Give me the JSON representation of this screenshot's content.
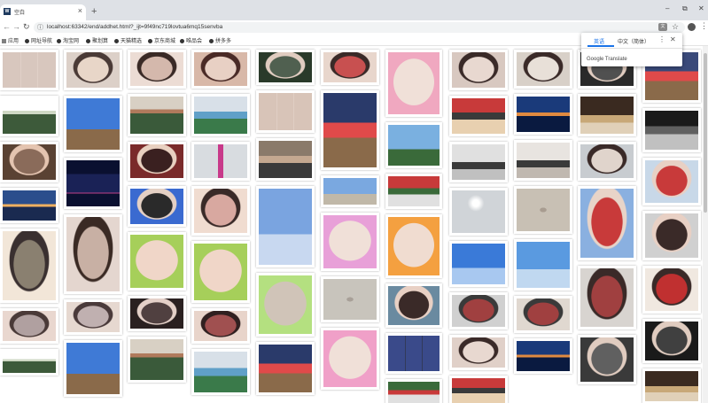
{
  "browser": {
    "tab_title": "空白",
    "tab_favicon": "W",
    "new_tab_label": "+",
    "window_controls": [
      "–",
      "⧉",
      "✕"
    ],
    "url": "localhost:63342/end/addhet.html?_ijt=9f49nc719lovtua6mq15senvba"
  },
  "bookmarks": [
    {
      "label": "应用",
      "icon": "apps-grid-icon"
    },
    {
      "label": "网址导航",
      "icon": "globe-icon"
    },
    {
      "label": "淘宝网",
      "icon": "globe-icon"
    },
    {
      "label": "聚划算",
      "icon": "globe-icon"
    },
    {
      "label": "天猫精选",
      "icon": "globe-icon"
    },
    {
      "label": "京东商城",
      "icon": "globe-icon"
    },
    {
      "label": "唯品会",
      "icon": "globe-icon"
    },
    {
      "label": "拼多多",
      "icon": "globe-icon"
    }
  ],
  "translate_popup": {
    "tab_english": "英语",
    "tab_chinese": "中文（简体）",
    "brand": "Google Translate"
  },
  "gallery": {
    "columns": [
      {
        "photos": [
          {
            "kind": "selfie-grid",
            "colors": [
              "#d8c7be",
              "#6a4a3a",
              "#e9dad3"
            ]
          },
          {
            "kind": "campus-building",
            "colors": [
              "#cfd8c4",
              "#3d5a3a",
              "#ffffff"
            ]
          },
          {
            "kind": "selfie",
            "colors": [
              "#5a4233",
              "#e4c4b0",
              "#8a6b5a"
            ]
          },
          {
            "kind": "city-skyline",
            "colors": [
              "#2b4e8c",
              "#f0b060",
              "#1a2a50"
            ]
          },
          {
            "kind": "sunset-portrait",
            "colors": [
              "#f2e6d8",
              "#3a3030",
              "#8a8070"
            ]
          },
          {
            "kind": "selfie",
            "colors": [
              "#e9d7cf",
              "#4a3a38",
              "#b0a0a0"
            ]
          },
          {
            "kind": "campus-building",
            "colors": [
              "#cfd8c4",
              "#3d5a3a",
              "#ffffff"
            ]
          }
        ]
      },
      {
        "photos": [
          {
            "kind": "portrait-glasses",
            "colors": [
              "#dcd0c8",
              "#4a3a36",
              "#e8d6c8"
            ]
          },
          {
            "kind": "blue-sky-girl",
            "colors": [
              "#3f7ad6",
              "#eaeaf2",
              "#8a6a4a"
            ]
          },
          {
            "kind": "night-tower",
            "colors": [
              "#1a2256",
              "#c04088",
              "#0a1030"
            ]
          },
          {
            "kind": "portrait",
            "colors": [
              "#e4d6cf",
              "#3a2a24",
              "#c8b0a4"
            ]
          },
          {
            "kind": "selfie",
            "colors": [
              "#e6d8d0",
              "#4a3a3a",
              "#c0b0b0"
            ]
          },
          {
            "kind": "blue-sky-girl",
            "colors": [
              "#3f7ad6",
              "#eaeaf2",
              "#8a6a4a"
            ]
          }
        ]
      },
      {
        "photos": [
          {
            "kind": "portrait",
            "colors": [
              "#ecdcd4",
              "#3a2a26",
              "#d4b8ac"
            ]
          },
          {
            "kind": "old-building",
            "colors": [
              "#b07a5c",
              "#3a5a3a",
              "#d8d0c4"
            ]
          },
          {
            "kind": "selfie",
            "colors": [
              "#7a2a2a",
              "#e8d0c0",
              "#3a2020"
            ]
          },
          {
            "kind": "couple",
            "colors": [
              "#3a6ad0",
              "#e4d0c4",
              "#2a2a2a"
            ]
          },
          {
            "kind": "avocado-frame",
            "colors": [
              "#a6cf5a",
              "#f0d6c8",
              "#3a2a24"
            ]
          },
          {
            "kind": "selfie-dark",
            "colors": [
              "#2a2020",
              "#e4d0c8",
              "#504040"
            ]
          },
          {
            "kind": "old-building",
            "colors": [
              "#b07a5c",
              "#3a5a3a",
              "#d8d0c4"
            ]
          }
        ]
      },
      {
        "photos": [
          {
            "kind": "portrait",
            "colors": [
              "#d8b8a8",
              "#4a2a26",
              "#e8d0c4"
            ]
          },
          {
            "kind": "park-fountain",
            "colors": [
              "#60a0c8",
              "#3a7a4a",
              "#d8e0e8"
            ]
          },
          {
            "kind": "canton-tower",
            "colors": [
              "#d8dce0",
              "#c83a8a",
              "#a0a8b0"
            ]
          },
          {
            "kind": "selfie-glasses",
            "colors": [
              "#f0dcd0",
              "#3a2a28",
              "#d8a8a0"
            ]
          },
          {
            "kind": "avocado-frame",
            "colors": [
              "#a6cf5a",
              "#f0d6c8",
              "#3a2a24"
            ]
          },
          {
            "kind": "selfie",
            "colors": [
              "#e8d4ca",
              "#302020",
              "#a05050"
            ]
          },
          {
            "kind": "park-fountain",
            "colors": [
              "#60a0c8",
              "#3a7a4a",
              "#d8e0e8"
            ]
          }
        ]
      },
      {
        "photos": [
          {
            "kind": "selfie-dark",
            "colors": [
              "#2a3a2a",
              "#e0ccc0",
              "#506050"
            ]
          },
          {
            "kind": "selfie-grid",
            "colors": [
              "#d8c4b8",
              "#4a3a34",
              "#e8d8d0"
            ]
          },
          {
            "kind": "street",
            "colors": [
              "#8a7a6a",
              "#c4a890",
              "#3a3a3a"
            ]
          },
          {
            "kind": "sculpture-sky",
            "colors": [
              "#7aa4e0",
              "#404850",
              "#c8d8f0"
            ]
          },
          {
            "kind": "heart-sand-frame",
            "colors": [
              "#b4e080",
              "#d0c4b8",
              "#6a5a50"
            ]
          },
          {
            "kind": "night-street",
            "colors": [
              "#2a3a6a",
              "#e04a4a",
              "#8a6a4a"
            ]
          }
        ]
      },
      {
        "photos": [
          {
            "kind": "selfie",
            "colors": [
              "#e8d6cc",
              "#3a2a28",
              "#c85050"
            ]
          },
          {
            "kind": "night-street",
            "colors": [
              "#2a3a6a",
              "#e04a4a",
              "#8a6a4a"
            ]
          },
          {
            "kind": "church",
            "colors": [
              "#7aa8e0",
              "#404850",
              "#c0b8a8"
            ]
          },
          {
            "kind": "pink-frame",
            "colors": [
              "#e8a0d8",
              "#f0e0d8",
              "#3a2a28"
            ]
          },
          {
            "kind": "heart-sand",
            "colors": [
              "#c8c4bc",
              "#a8a098",
              "#e0dcd4"
            ]
          },
          {
            "kind": "pink-frame",
            "colors": [
              "#f0a0c8",
              "#f0e0d8",
              "#3a2a28"
            ]
          }
        ]
      },
      {
        "photos": [
          {
            "kind": "pink-frame",
            "colors": [
              "#f0a8c0",
              "#f0e0d8",
              "#3a2a28"
            ]
          },
          {
            "kind": "yellow-church",
            "colors": [
              "#7ab0e0",
              "#d8c060",
              "#3a6a3a"
            ]
          },
          {
            "kind": "factory-sign",
            "colors": [
              "#c83a3a",
              "#3a6a3a",
              "#e0e0e0"
            ]
          },
          {
            "kind": "orange-frame",
            "colors": [
              "#f4a040",
              "#f0dcd0",
              "#3a2a28"
            ]
          },
          {
            "kind": "selfie-glasses",
            "colors": [
              "#6a8aa0",
              "#e8d0c4",
              "#3a2a28"
            ]
          },
          {
            "kind": "selfie-grid",
            "colors": [
              "#3a4a8a",
              "#e0ccc0",
              "#2a2a2a"
            ]
          },
          {
            "kind": "tree-building",
            "colors": [
              "#3a6a3a",
              "#c83a3a",
              "#e0e0e0"
            ]
          }
        ]
      },
      {
        "photos": [
          {
            "kind": "selfie-cat",
            "colors": [
              "#d8c8c0",
              "#3a2a28",
              "#e8d8d0"
            ]
          },
          {
            "kind": "market",
            "colors": [
              "#c83a3a",
              "#3a3a3a",
              "#e8d0b0"
            ]
          },
          {
            "kind": "room",
            "colors": [
              "#e0e0e0",
              "#3a3a3a",
              "#c0c0c0"
            ]
          },
          {
            "kind": "sun-sky",
            "colors": [
              "#d0d4d8",
              "#3a3a3a",
              "#f0f0f0"
            ]
          },
          {
            "kind": "sculpture-sky",
            "colors": [
              "#3a7ad8",
              "#303840",
              "#a8c8f0"
            ]
          },
          {
            "kind": "selfie-couple",
            "colors": [
              "#d0d0d0",
              "#3a3a3a",
              "#a04040"
            ]
          },
          {
            "kind": "selfie-cat",
            "colors": [
              "#e0d0c8",
              "#3a2a28",
              "#e8d8d0"
            ]
          },
          {
            "kind": "market",
            "colors": [
              "#c83a3a",
              "#3a3a3a",
              "#e8d0b0"
            ]
          }
        ]
      },
      {
        "photos": [
          {
            "kind": "selfie",
            "colors": [
              "#d8d0c8",
              "#3a2a28",
              "#e8e0d8"
            ]
          },
          {
            "kind": "city-night",
            "colors": [
              "#1a3a7a",
              "#e08a40",
              "#0a1a40"
            ]
          },
          {
            "kind": "classroom",
            "colors": [
              "#e8e4e0",
              "#3a3a3a",
              "#c0b8b0"
            ]
          },
          {
            "kind": "heart-sand",
            "colors": [
              "#c8c0b4",
              "#a89c90",
              "#e0d8d0"
            ]
          },
          {
            "kind": "sculpture-sky",
            "colors": [
              "#5a9ae0",
              "#303840",
              "#c0d8f0"
            ]
          },
          {
            "kind": "selfie-couple",
            "colors": [
              "#e0d8d0",
              "#3a3a3a",
              "#a04040"
            ]
          },
          {
            "kind": "city-night",
            "colors": [
              "#1a3a7a",
              "#e08a40",
              "#0a1a40"
            ]
          }
        ]
      },
      {
        "photos": [
          {
            "kind": "selfie-dark",
            "colors": [
              "#2a2a2a",
              "#e0ccc0",
              "#505050"
            ]
          },
          {
            "kind": "restaurant",
            "colors": [
              "#3a2a20",
              "#c8a878",
              "#e0d0b8"
            ]
          },
          {
            "kind": "selfie",
            "colors": [
              "#c8ccd0",
              "#3a2a28",
              "#e0d4cc"
            ]
          },
          {
            "kind": "portrait-blue",
            "colors": [
              "#8ab0e0",
              "#e8d4c8",
              "#c83a3a"
            ]
          },
          {
            "kind": "selfie-boy",
            "colors": [
              "#d8d4d0",
              "#3a2a28",
              "#a04040"
            ]
          },
          {
            "kind": "selfie-dark",
            "colors": [
              "#3a3a3a",
              "#e0ccc0",
              "#606060"
            ]
          }
        ]
      },
      {
        "photos": [
          {
            "kind": "night-street",
            "colors": [
              "#3a4a7a",
              "#e04a4a",
              "#8a6a4a"
            ]
          },
          {
            "kind": "street-dark",
            "colors": [
              "#1a1a1a",
              "#606060",
              "#c0c0c0"
            ]
          },
          {
            "kind": "selfie-glasses",
            "colors": [
              "#c8d8e8",
              "#e8d0c4",
              "#c83a3a"
            ]
          },
          {
            "kind": "selfie-glasses",
            "colors": [
              "#d0d0d0",
              "#e8d0c4",
              "#3a2a28"
            ]
          },
          {
            "kind": "selfie-red",
            "colors": [
              "#f0e8e0",
              "#3a2a28",
              "#c03030"
            ]
          },
          {
            "kind": "selfie-dark",
            "colors": [
              "#1a1a1a",
              "#e0ccc0",
              "#404040"
            ]
          },
          {
            "kind": "restaurant",
            "colors": [
              "#3a2a20",
              "#c8a878",
              "#e0d0b8"
            ]
          }
        ]
      }
    ]
  }
}
